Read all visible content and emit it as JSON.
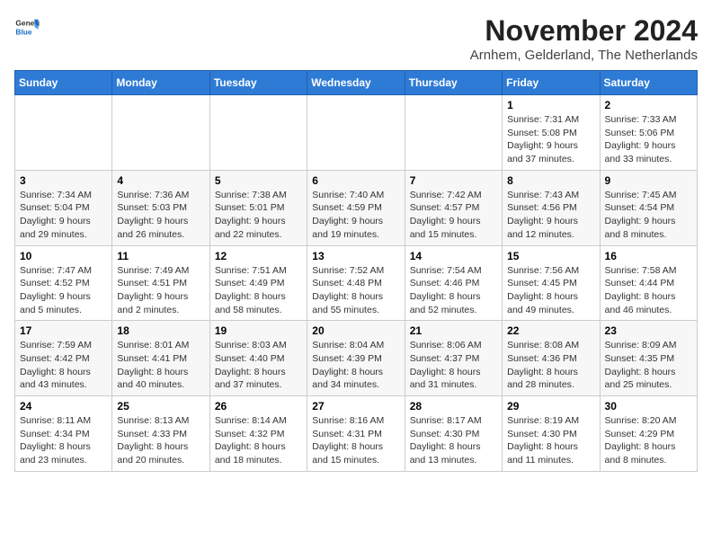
{
  "logo": {
    "general": "General",
    "blue": "Blue"
  },
  "header": {
    "month": "November 2024",
    "location": "Arnhem, Gelderland, The Netherlands"
  },
  "days_of_week": [
    "Sunday",
    "Monday",
    "Tuesday",
    "Wednesday",
    "Thursday",
    "Friday",
    "Saturday"
  ],
  "weeks": [
    [
      {
        "day": "",
        "info": ""
      },
      {
        "day": "",
        "info": ""
      },
      {
        "day": "",
        "info": ""
      },
      {
        "day": "",
        "info": ""
      },
      {
        "day": "",
        "info": ""
      },
      {
        "day": "1",
        "info": "Sunrise: 7:31 AM\nSunset: 5:08 PM\nDaylight: 9 hours and 37 minutes."
      },
      {
        "day": "2",
        "info": "Sunrise: 7:33 AM\nSunset: 5:06 PM\nDaylight: 9 hours and 33 minutes."
      }
    ],
    [
      {
        "day": "3",
        "info": "Sunrise: 7:34 AM\nSunset: 5:04 PM\nDaylight: 9 hours and 29 minutes."
      },
      {
        "day": "4",
        "info": "Sunrise: 7:36 AM\nSunset: 5:03 PM\nDaylight: 9 hours and 26 minutes."
      },
      {
        "day": "5",
        "info": "Sunrise: 7:38 AM\nSunset: 5:01 PM\nDaylight: 9 hours and 22 minutes."
      },
      {
        "day": "6",
        "info": "Sunrise: 7:40 AM\nSunset: 4:59 PM\nDaylight: 9 hours and 19 minutes."
      },
      {
        "day": "7",
        "info": "Sunrise: 7:42 AM\nSunset: 4:57 PM\nDaylight: 9 hours and 15 minutes."
      },
      {
        "day": "8",
        "info": "Sunrise: 7:43 AM\nSunset: 4:56 PM\nDaylight: 9 hours and 12 minutes."
      },
      {
        "day": "9",
        "info": "Sunrise: 7:45 AM\nSunset: 4:54 PM\nDaylight: 9 hours and 8 minutes."
      }
    ],
    [
      {
        "day": "10",
        "info": "Sunrise: 7:47 AM\nSunset: 4:52 PM\nDaylight: 9 hours and 5 minutes."
      },
      {
        "day": "11",
        "info": "Sunrise: 7:49 AM\nSunset: 4:51 PM\nDaylight: 9 hours and 2 minutes."
      },
      {
        "day": "12",
        "info": "Sunrise: 7:51 AM\nSunset: 4:49 PM\nDaylight: 8 hours and 58 minutes."
      },
      {
        "day": "13",
        "info": "Sunrise: 7:52 AM\nSunset: 4:48 PM\nDaylight: 8 hours and 55 minutes."
      },
      {
        "day": "14",
        "info": "Sunrise: 7:54 AM\nSunset: 4:46 PM\nDaylight: 8 hours and 52 minutes."
      },
      {
        "day": "15",
        "info": "Sunrise: 7:56 AM\nSunset: 4:45 PM\nDaylight: 8 hours and 49 minutes."
      },
      {
        "day": "16",
        "info": "Sunrise: 7:58 AM\nSunset: 4:44 PM\nDaylight: 8 hours and 46 minutes."
      }
    ],
    [
      {
        "day": "17",
        "info": "Sunrise: 7:59 AM\nSunset: 4:42 PM\nDaylight: 8 hours and 43 minutes."
      },
      {
        "day": "18",
        "info": "Sunrise: 8:01 AM\nSunset: 4:41 PM\nDaylight: 8 hours and 40 minutes."
      },
      {
        "day": "19",
        "info": "Sunrise: 8:03 AM\nSunset: 4:40 PM\nDaylight: 8 hours and 37 minutes."
      },
      {
        "day": "20",
        "info": "Sunrise: 8:04 AM\nSunset: 4:39 PM\nDaylight: 8 hours and 34 minutes."
      },
      {
        "day": "21",
        "info": "Sunrise: 8:06 AM\nSunset: 4:37 PM\nDaylight: 8 hours and 31 minutes."
      },
      {
        "day": "22",
        "info": "Sunrise: 8:08 AM\nSunset: 4:36 PM\nDaylight: 8 hours and 28 minutes."
      },
      {
        "day": "23",
        "info": "Sunrise: 8:09 AM\nSunset: 4:35 PM\nDaylight: 8 hours and 25 minutes."
      }
    ],
    [
      {
        "day": "24",
        "info": "Sunrise: 8:11 AM\nSunset: 4:34 PM\nDaylight: 8 hours and 23 minutes."
      },
      {
        "day": "25",
        "info": "Sunrise: 8:13 AM\nSunset: 4:33 PM\nDaylight: 8 hours and 20 minutes."
      },
      {
        "day": "26",
        "info": "Sunrise: 8:14 AM\nSunset: 4:32 PM\nDaylight: 8 hours and 18 minutes."
      },
      {
        "day": "27",
        "info": "Sunrise: 8:16 AM\nSunset: 4:31 PM\nDaylight: 8 hours and 15 minutes."
      },
      {
        "day": "28",
        "info": "Sunrise: 8:17 AM\nSunset: 4:30 PM\nDaylight: 8 hours and 13 minutes."
      },
      {
        "day": "29",
        "info": "Sunrise: 8:19 AM\nSunset: 4:30 PM\nDaylight: 8 hours and 11 minutes."
      },
      {
        "day": "30",
        "info": "Sunrise: 8:20 AM\nSunset: 4:29 PM\nDaylight: 8 hours and 8 minutes."
      }
    ]
  ]
}
